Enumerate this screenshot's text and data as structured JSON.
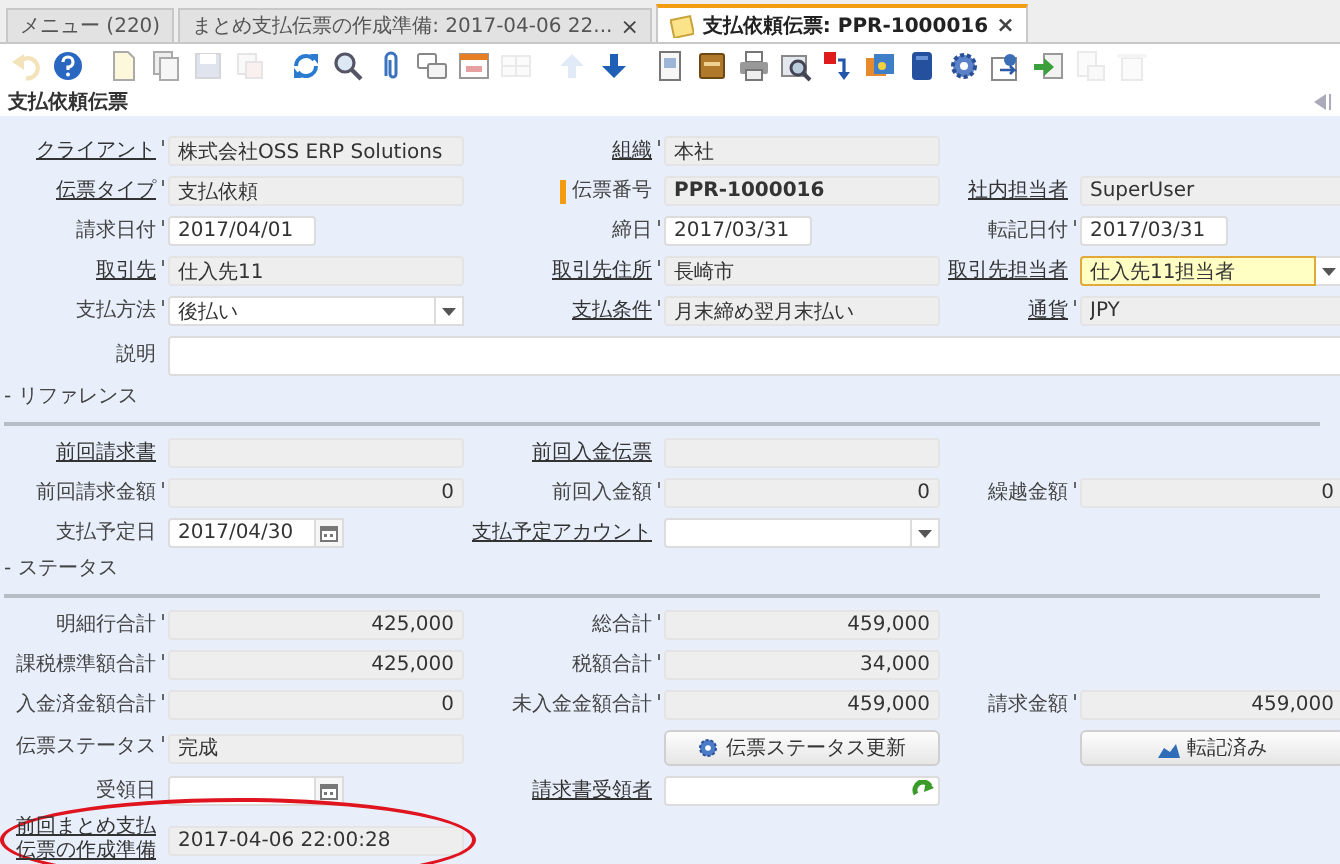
{
  "tabs": [
    {
      "label": "メニュー (220)",
      "selected": false,
      "icon": false
    },
    {
      "label": "まとめ支払伝票の作成準備: 2017-04-06 22...",
      "close": "×",
      "selected": false,
      "icon": false
    },
    {
      "label": "支払依頼伝票: PPR-1000016",
      "close": "×",
      "selected": true,
      "icon": true
    }
  ],
  "toolbar": [
    [
      {
        "kind": "undo",
        "disabled": true
      },
      {
        "kind": "help",
        "disabled": false
      }
    ],
    [
      {
        "kind": "new",
        "disabled": false
      },
      {
        "kind": "copy",
        "disabled": false
      },
      {
        "kind": "save",
        "disabled": true
      },
      {
        "kind": "delete",
        "disabled": true
      }
    ],
    [
      {
        "kind": "refresh",
        "disabled": false
      },
      {
        "kind": "find",
        "disabled": false
      },
      {
        "kind": "attachment",
        "disabled": false
      },
      {
        "kind": "chat",
        "disabled": false
      },
      {
        "kind": "window",
        "disabled": false
      },
      {
        "kind": "grid",
        "disabled": true
      }
    ],
    [
      {
        "kind": "up",
        "disabled": true
      },
      {
        "kind": "down",
        "disabled": false
      }
    ],
    [
      {
        "kind": "report",
        "disabled": false
      },
      {
        "kind": "archive",
        "disabled": false
      },
      {
        "kind": "print",
        "disabled": false
      },
      {
        "kind": "zoom",
        "disabled": false
      },
      {
        "kind": "request",
        "disabled": false
      },
      {
        "kind": "product",
        "disabled": false
      },
      {
        "kind": "workflow",
        "disabled": false
      },
      {
        "kind": "process",
        "disabled": false
      },
      {
        "kind": "customize",
        "disabled": false
      },
      {
        "kind": "import",
        "disabled": false
      },
      {
        "kind": "export",
        "disabled": true
      },
      {
        "kind": "trash",
        "disabled": true
      }
    ]
  ],
  "title": "支払依頼伝票",
  "sections": [
    {
      "rows": [
        {
          "left": {
            "label": "クライアント",
            "link": true,
            "marked": true,
            "kind": "text",
            "value": "株式会社OSS ERP Solutions",
            "readonly": true
          },
          "middle": {
            "label": "組織",
            "link": true,
            "marked": true,
            "kind": "text",
            "value": "本社",
            "readonly": true
          }
        },
        {
          "left": {
            "label": "伝票タイプ",
            "link": true,
            "marked": true,
            "kind": "text",
            "value": "支払依頼",
            "readonly": true
          },
          "middle": {
            "label": "伝票番号",
            "required": true,
            "kind": "text",
            "value": "PPR-1000016",
            "bold": true,
            "readonly": true
          },
          "right": {
            "label": "社内担当者",
            "link": true,
            "kind": "text",
            "value": "SuperUser",
            "readonly": true
          }
        },
        {
          "left": {
            "label": "請求日付",
            "marked": true,
            "kind": "date",
            "value": "2017/04/01",
            "readonly": false
          },
          "middle": {
            "label": "締日",
            "marked": true,
            "kind": "date",
            "value": "2017/03/31",
            "readonly": false
          },
          "right": {
            "label": "転記日付",
            "marked": true,
            "kind": "date",
            "value": "2017/03/31",
            "readonly": false
          }
        },
        {
          "left": {
            "label": "取引先",
            "link": true,
            "marked": true,
            "kind": "text",
            "value": "仕入先11",
            "readonly": true
          },
          "middle": {
            "label": "取引先住所",
            "link": true,
            "marked": true,
            "kind": "text",
            "value": "長崎市",
            "readonly": true
          },
          "right": {
            "label": "取引先担当者",
            "link": true,
            "kind": "select",
            "value": "仕入先11担当者",
            "focused": true,
            "readonly": false
          }
        },
        {
          "left": {
            "label": "支払方法",
            "marked": true,
            "kind": "select",
            "value": "後払い",
            "readonly": false
          },
          "middle": {
            "label": "支払条件",
            "link": true,
            "marked": true,
            "kind": "text",
            "value": "月末締め翌月末払い",
            "readonly": true
          },
          "right": {
            "label": "通貨",
            "link": true,
            "marked": true,
            "kind": "text",
            "value": "JPY",
            "readonly": true
          }
        },
        {
          "left": {
            "label": "説明",
            "kind": "textarea",
            "readonly": false
          }
        }
      ]
    },
    {
      "header": "- リファレンス",
      "rows": [
        {
          "left": {
            "label": "前回請求書",
            "link": true,
            "kind": "text",
            "readonly": true
          },
          "middle": {
            "label": "前回入金伝票",
            "link": true,
            "kind": "text",
            "readonly": true
          }
        },
        {
          "left": {
            "label": "前回請求金額",
            "marked": true,
            "kind": "number",
            "value": "0",
            "readonly": true
          },
          "middle": {
            "label": "前回入金額",
            "marked": true,
            "kind": "number",
            "value": "0",
            "readonly": true
          },
          "right": {
            "label": "繰越金額",
            "marked": true,
            "kind": "number",
            "value": "0",
            "readonly": true
          }
        },
        {
          "left": {
            "label": "支払予定日",
            "kind": "datepicker",
            "value": "2017/04/30",
            "readonly": false
          },
          "middle": {
            "label": "支払予定アカウント",
            "link": true,
            "kind": "select",
            "readonly": false
          }
        }
      ]
    },
    {
      "header": "- ステータス",
      "rows": [
        {
          "left": {
            "label": "明細行合計",
            "marked": true,
            "kind": "number",
            "value": "425,000",
            "readonly": true
          },
          "middle": {
            "label": "総合計",
            "marked": true,
            "kind": "number",
            "value": "459,000",
            "readonly": true
          }
        },
        {
          "left": {
            "label": "課税標準額合計",
            "marked": true,
            "kind": "number",
            "value": "425,000",
            "readonly": true
          },
          "middle": {
            "label": "税額合計",
            "marked": true,
            "kind": "number",
            "value": "34,000",
            "readonly": true
          }
        },
        {
          "left": {
            "label": "入金済金額合計",
            "marked": true,
            "kind": "number",
            "value": "0",
            "readonly": true
          },
          "middle": {
            "label": "未入金金額合計",
            "marked": true,
            "kind": "number",
            "value": "459,000",
            "readonly": true
          },
          "right": {
            "label": "請求金額",
            "marked": true,
            "kind": "number",
            "value": "459,000",
            "readonly": true
          }
        },
        {
          "left": {
            "label": "伝票ステータス",
            "marked": true,
            "kind": "text",
            "value": "完成",
            "readonly": true
          },
          "middle": {
            "kind": "button",
            "text": "伝票ステータス更新"
          },
          "right": {
            "kind": "button",
            "text": "転記済み"
          }
        },
        {
          "left": {
            "label": "受領日",
            "kind": "datepicker",
            "readonly": false
          },
          "middle": {
            "label": "請求書受領者",
            "link": true,
            "kind": "lookup",
            "readonly": false
          }
        },
        {
          "left": {
            "label": "前回まとめ支払伝票の作成準備",
            "link": true,
            "kind": "text",
            "value": "2017-04-06 22:00:28",
            "readonly": true,
            "circled": true
          }
        }
      ]
    }
  ]
}
